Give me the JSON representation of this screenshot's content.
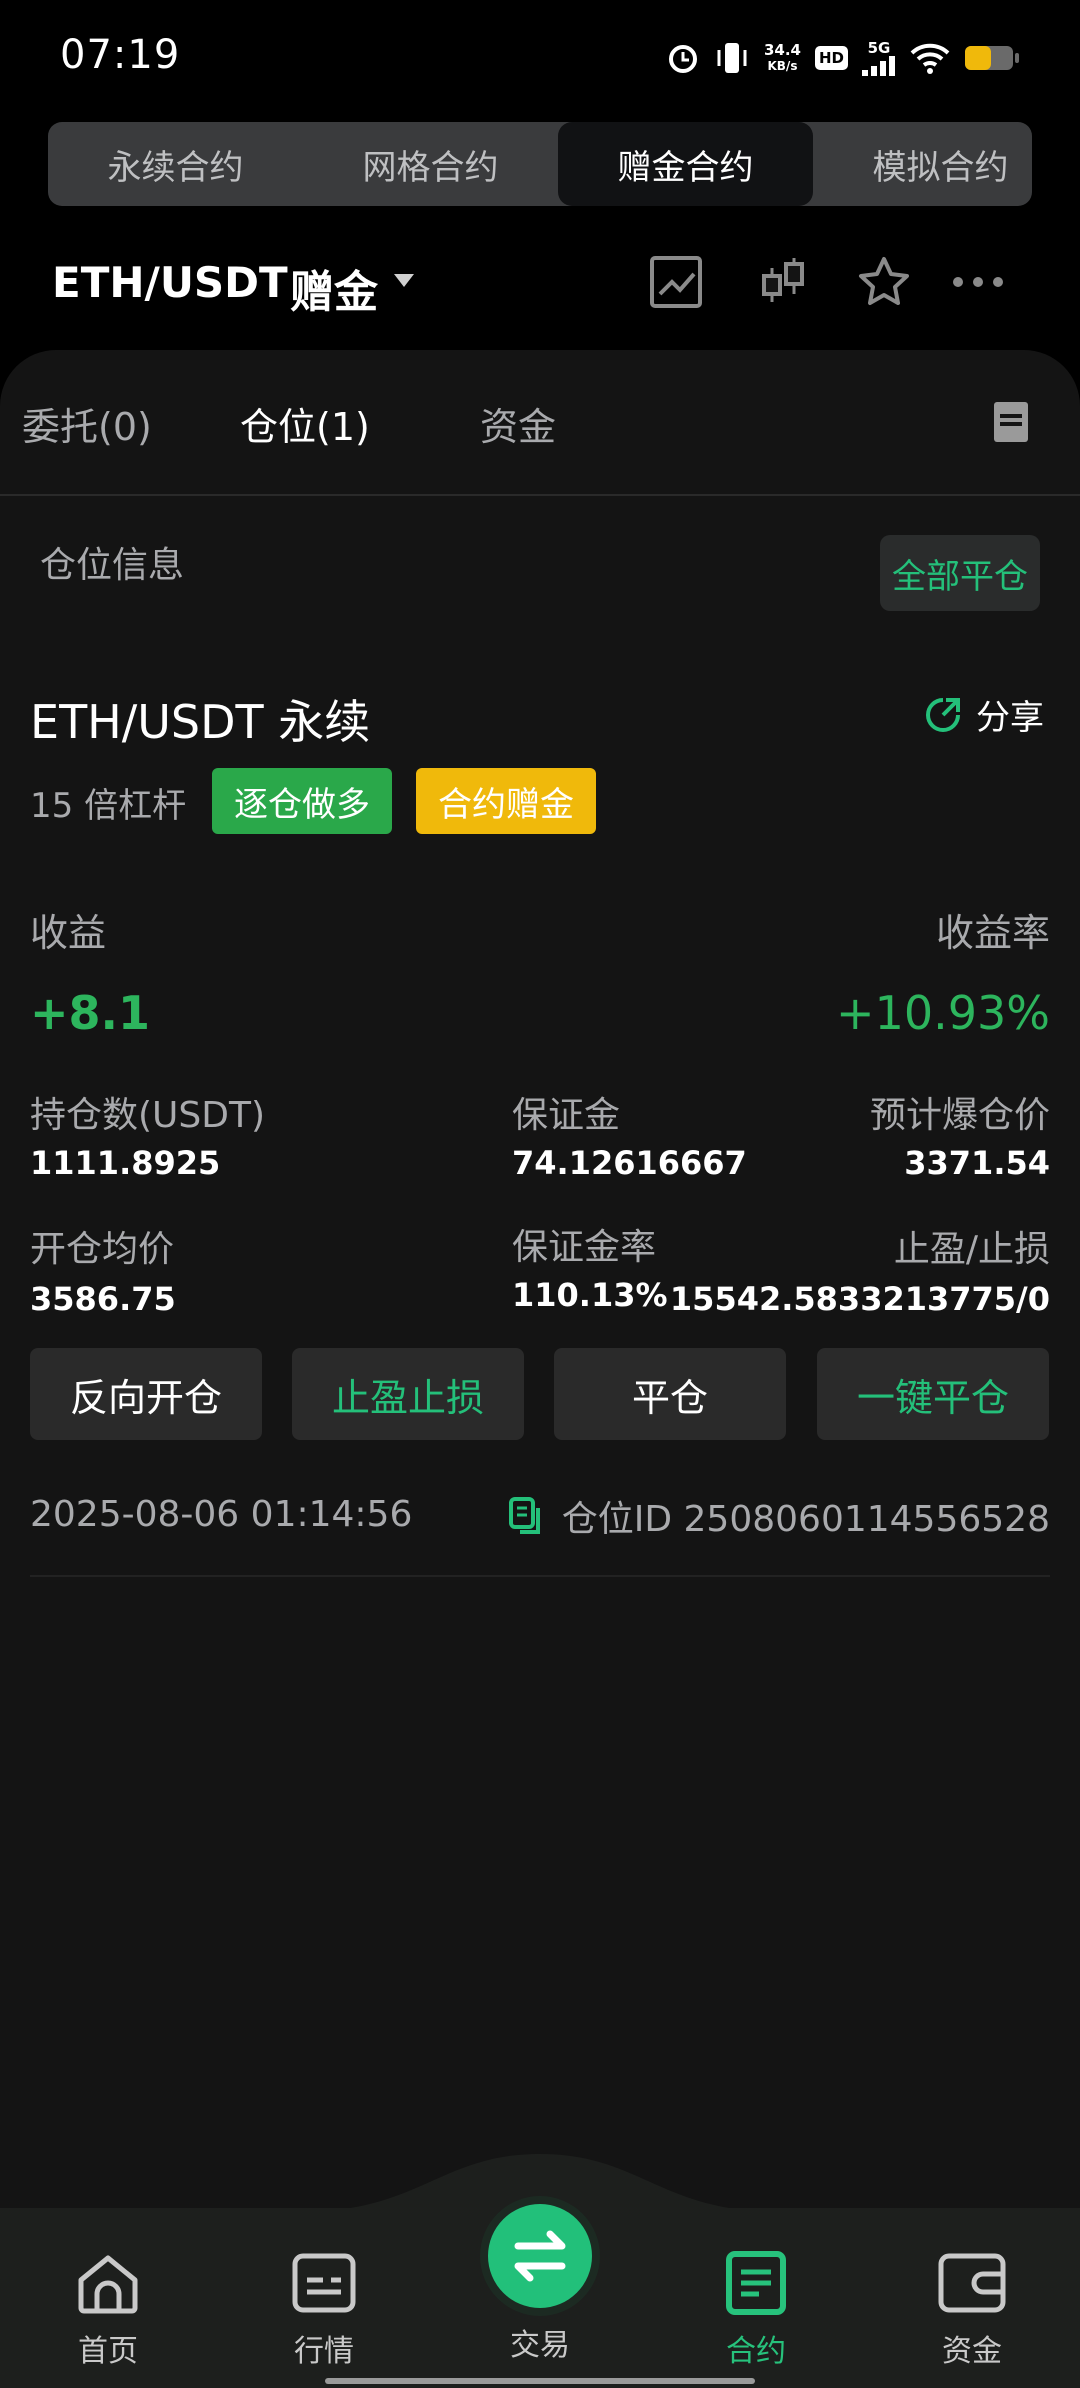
{
  "status_bar": {
    "time": "07:19",
    "net_speed": "34.4",
    "net_unit": "KB/s",
    "hd": "HD",
    "cell": "5G",
    "icons": [
      "alarm-icon",
      "vibrate-icon",
      "hd-icon",
      "signal-icon",
      "wifi-icon",
      "battery-icon"
    ]
  },
  "top_tabs": [
    {
      "label": "永续合约"
    },
    {
      "label": "网格合约"
    },
    {
      "label": "赠金合约"
    },
    {
      "label": "模拟合约"
    }
  ],
  "header": {
    "pair": "ETH/USDT",
    "mode": "赠金",
    "icons": [
      "line-chart-icon",
      "candlestick-icon",
      "star-icon",
      "more-icon"
    ]
  },
  "sub_tabs": [
    {
      "label": "委托(0)"
    },
    {
      "label": "仓位(1)"
    },
    {
      "label": "资金"
    }
  ],
  "section": {
    "title": "仓位信息",
    "close_all": "全部平仓"
  },
  "position": {
    "symbol": "ETH/USDT 永续",
    "share": "分享",
    "leverage": "15 倍杠杆",
    "badge_direction": "逐仓做多",
    "badge_bonus": "合约赠金",
    "pnl_label": "收益",
    "pnl_rate_label": "收益率",
    "pnl_value": "+8.1",
    "pnl_rate_value": "+10.93%",
    "size_label": "持仓数(USDT)",
    "size_value": "1111.8925",
    "margin_label": "保证金",
    "margin_value": "74.12616667",
    "liq_label": "预计爆仓价",
    "liq_value": "3371.54",
    "entry_label": "开仓均价",
    "entry_value": "3586.75",
    "margin_rate_label": "保证金率",
    "margin_rate_value": "110.13%",
    "tpsl_label": "止盈/止损",
    "tpsl_value": "15542.5833213775/0",
    "buttons": {
      "reverse": "反向开仓",
      "tpsl": "止盈止损",
      "close": "平仓",
      "one_click_close": "一键平仓"
    },
    "opened_time": "2025-08-06 01:14:56",
    "position_id": "仓位ID 2508060114556528"
  },
  "bottom_nav": [
    {
      "label": "首页",
      "icon": "home-icon"
    },
    {
      "label": "行情",
      "icon": "market-icon"
    },
    {
      "label": "交易",
      "icon": "trade-icon"
    },
    {
      "label": "合约",
      "icon": "contract-icon"
    },
    {
      "label": "资金",
      "icon": "wallet-icon"
    }
  ],
  "colors": {
    "accent_green": "#24c07a",
    "profit_green": "#2db55d",
    "badge_yellow": "#f0b90b",
    "badge_green": "#2aa84a"
  }
}
